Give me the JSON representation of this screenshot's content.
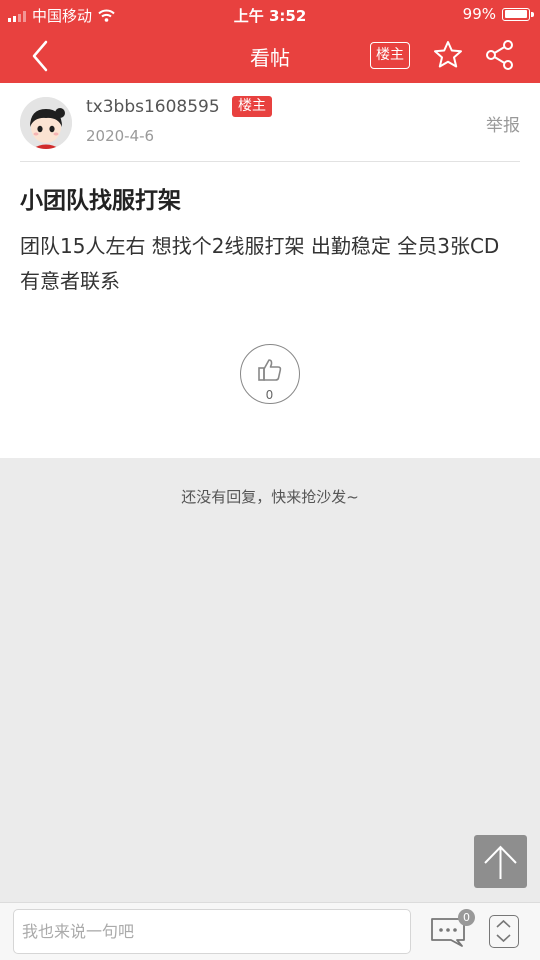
{
  "status_bar": {
    "carrier": "中国移动",
    "time": "上午 3:52",
    "battery": "99%",
    "battery_level": 0.99
  },
  "nav": {
    "title": "看帖",
    "owner_only_label": "楼主",
    "icons": [
      "back-chevron-icon",
      "star-icon",
      "share-icon"
    ]
  },
  "post": {
    "username": "tx3bbs1608595",
    "owner_badge": "楼主",
    "date": "2020-4-6",
    "report_label": "举报",
    "title": "小团队找服打架",
    "body": "团队15人左右 想找个2线服打架 出勤稳定 全员3张CD 有意者联系",
    "like_count": "0"
  },
  "replies": {
    "empty_text": "还没有回复，快来抢沙发~"
  },
  "bottom_bar": {
    "input_placeholder": "我也来说一句吧",
    "comment_count": "0"
  },
  "colors": {
    "brand_red": "#e8413f",
    "page_background": "#ebebeb"
  }
}
